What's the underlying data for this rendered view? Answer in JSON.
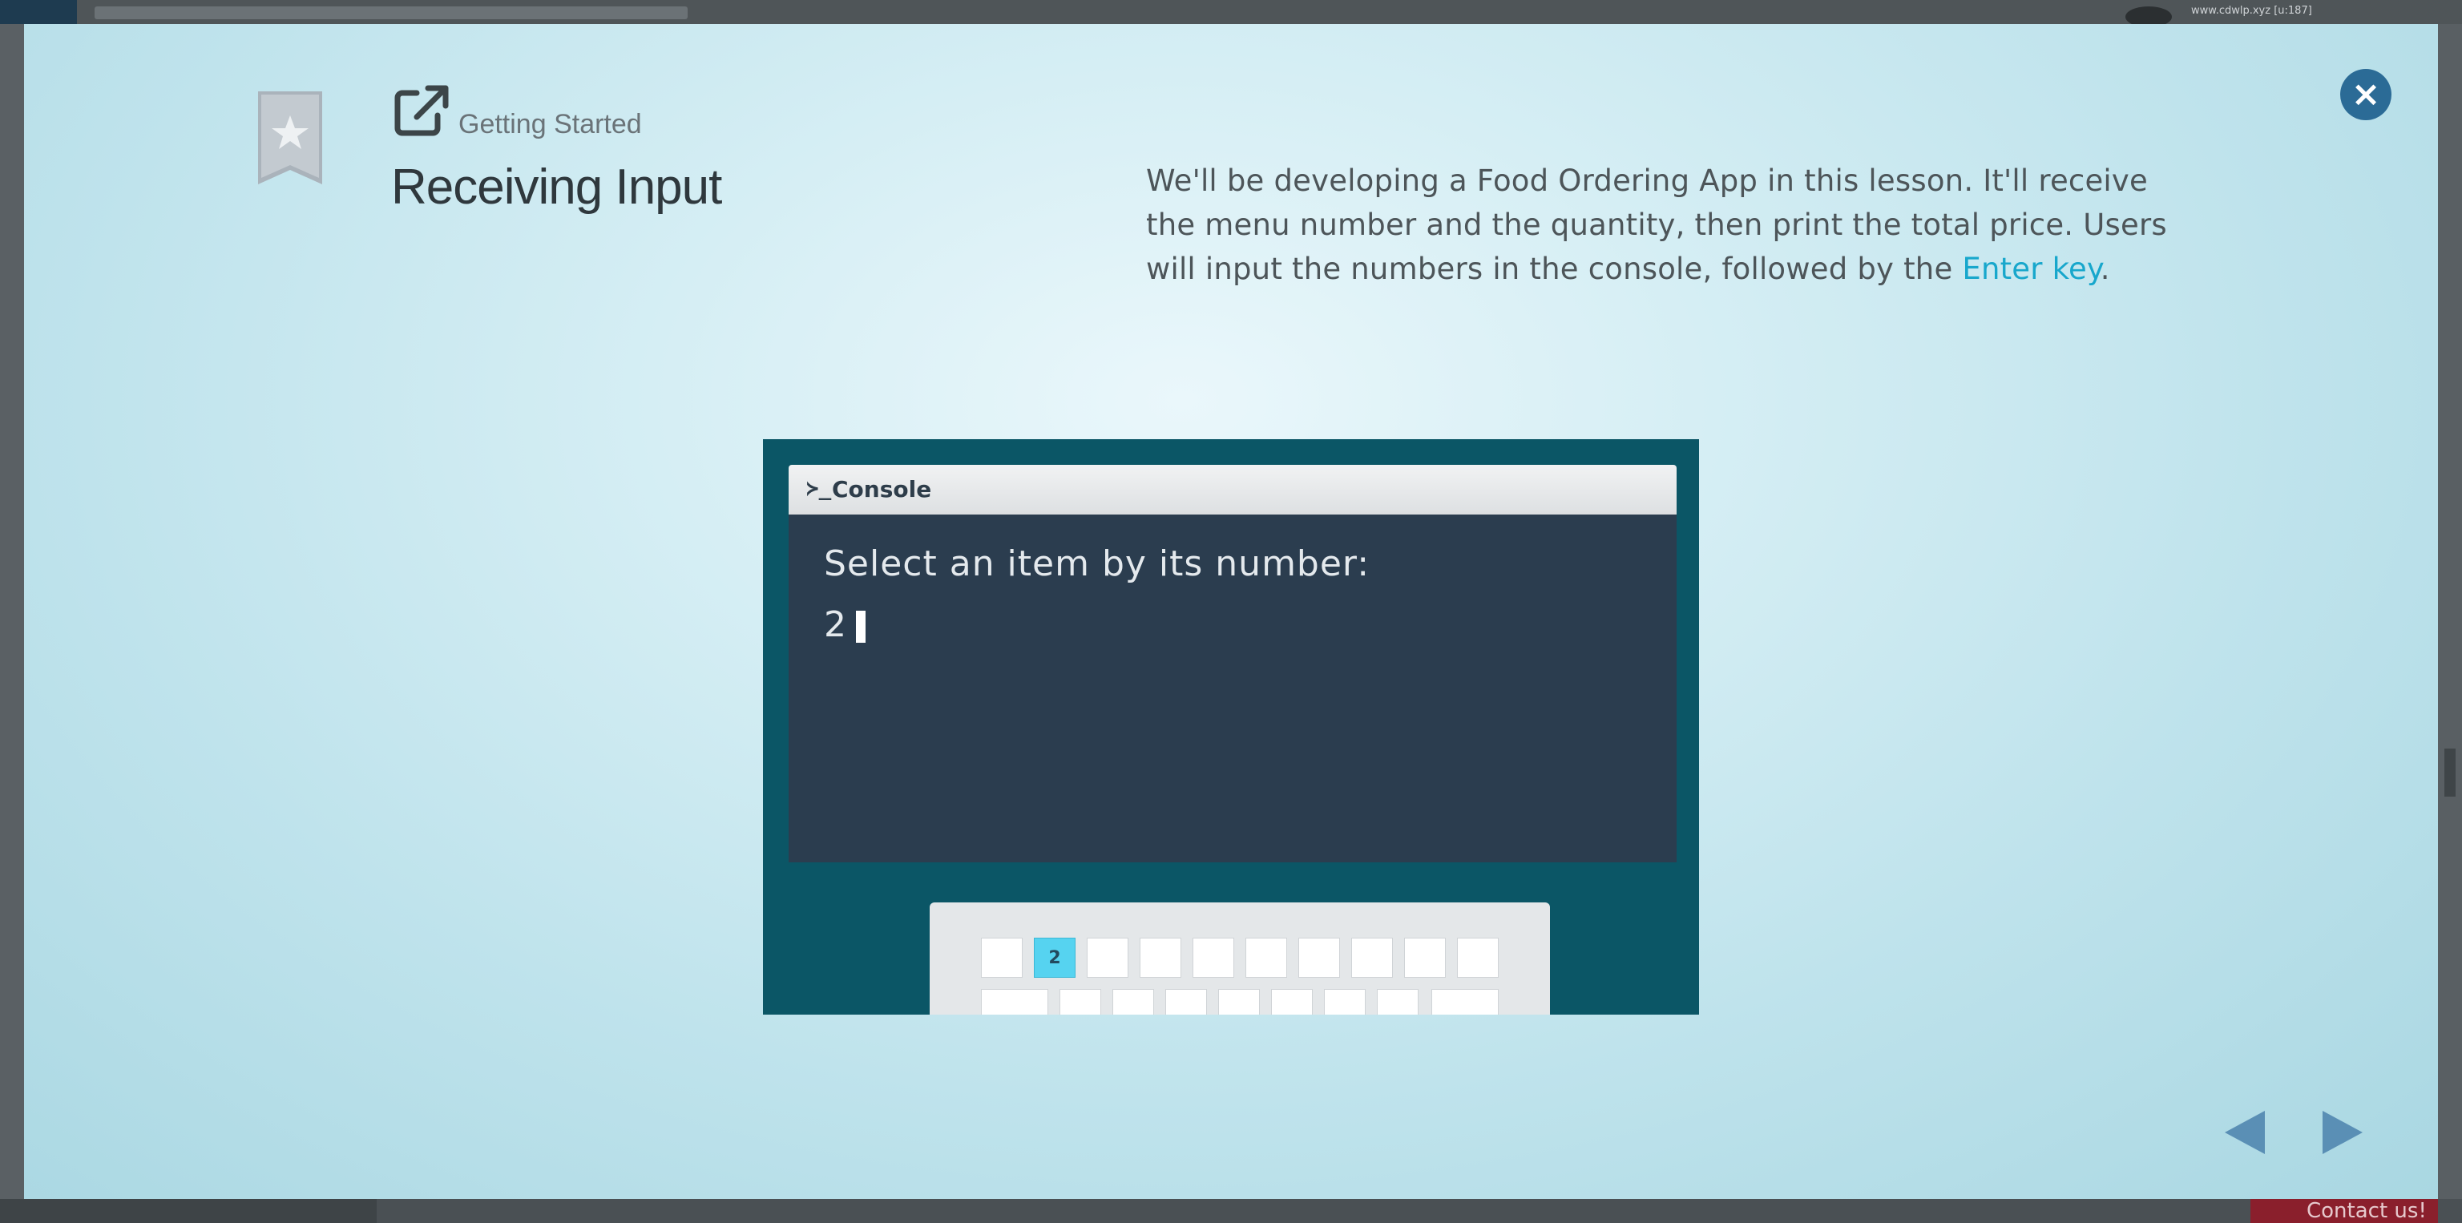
{
  "background": {
    "url_text": "www.cdwlp.xyz [u:187]",
    "contact_label": "Contact us!"
  },
  "modal": {
    "breadcrumb": "Getting Started",
    "title": "Receiving Input",
    "description": {
      "text": "We'll be developing a Food Ordering App in this lesson. It'll receive the menu number and the quantity, then print the total price. Users will input the numbers in the console, followed by the ",
      "link": "Enter key",
      "end": "."
    },
    "close_icon": "×"
  },
  "illustration": {
    "console_prompt_glyph": "≻_",
    "console_title": "Console",
    "prompt_text": "Select an item by its number:",
    "input_value": "2",
    "active_key_label": "2"
  },
  "navigation": {
    "prev_icon": "triangle-left-icon",
    "next_icon": "triangle-right-icon"
  },
  "colors": {
    "accent_link": "#18a7cc",
    "close_button": "#2b6b96",
    "illustration_bg": "#0b5666",
    "console_bg": "#2b3d4f",
    "active_key": "#56d3f0",
    "nav_arrows": "#5a8fb5"
  }
}
